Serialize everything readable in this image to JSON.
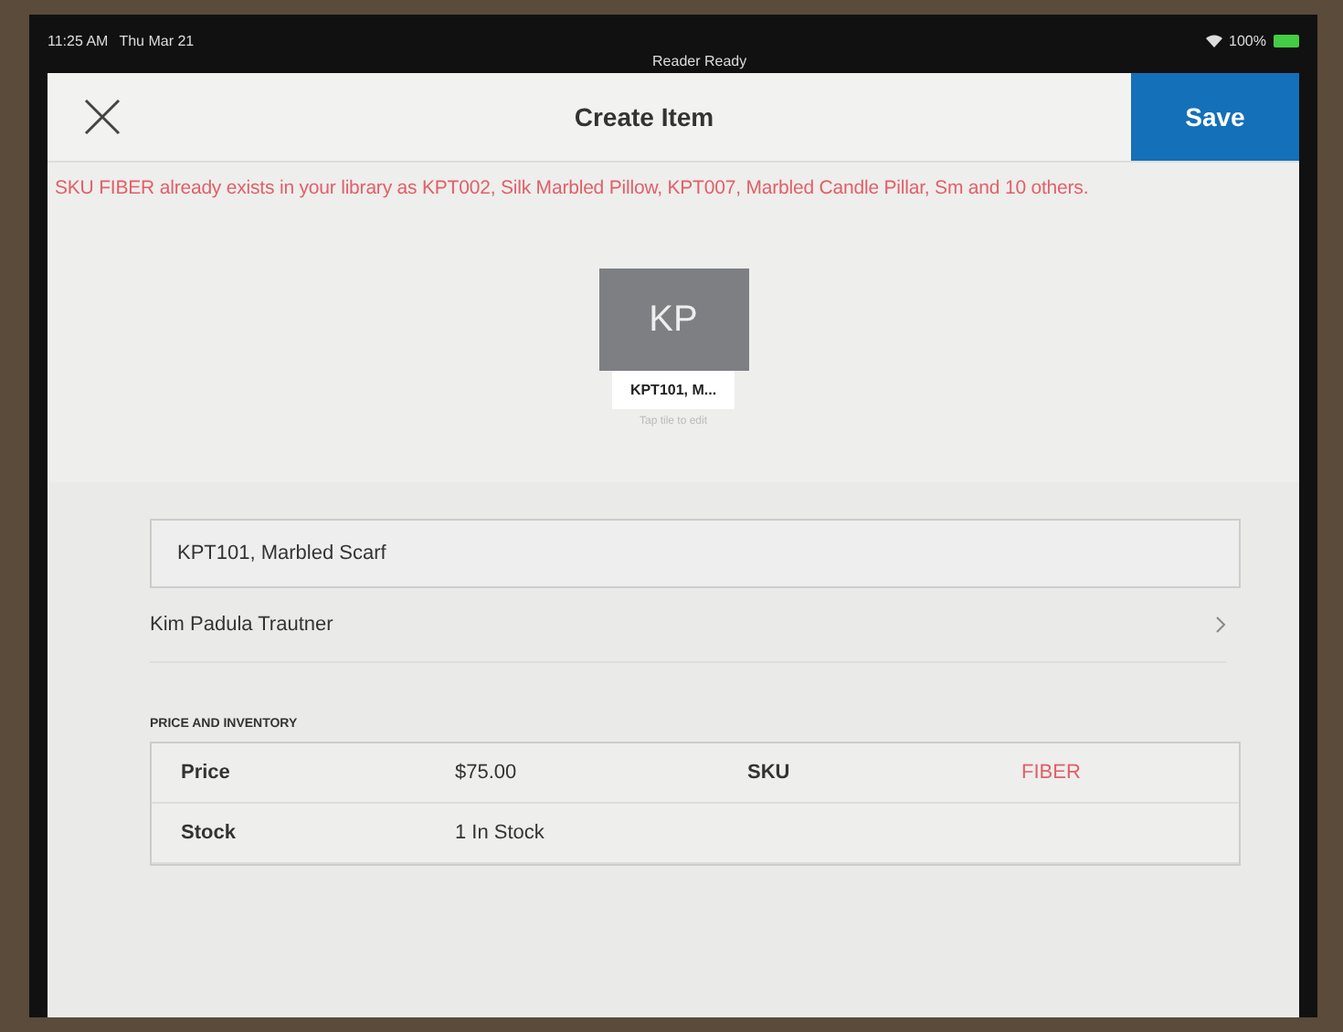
{
  "status_bar": {
    "time": "11:25 AM",
    "date": "Thu Mar 21",
    "reader": "Reader Ready",
    "battery": "100%"
  },
  "header": {
    "title": "Create Item",
    "save": "Save"
  },
  "error": "SKU FIBER already exists in your library as KPT002, Silk Marbled Pillow, KPT007, Marbled Candle Pillar, Sm and 10 others.",
  "tile": {
    "initials": "KP",
    "label": "KPT101, M...",
    "hint": "Tap tile to edit"
  },
  "name_field": {
    "value": "KPT101, Marbled Scarf"
  },
  "category_row": {
    "label": "Kim Padula Trautner"
  },
  "section": {
    "title": "PRICE AND INVENTORY"
  },
  "rows": [
    {
      "label": "Price",
      "value": "$75.00",
      "label_2": "SKU",
      "value_2": "FIBER",
      "error": true
    },
    {
      "label": "Stock",
      "value": "1 In Stock"
    }
  ]
}
